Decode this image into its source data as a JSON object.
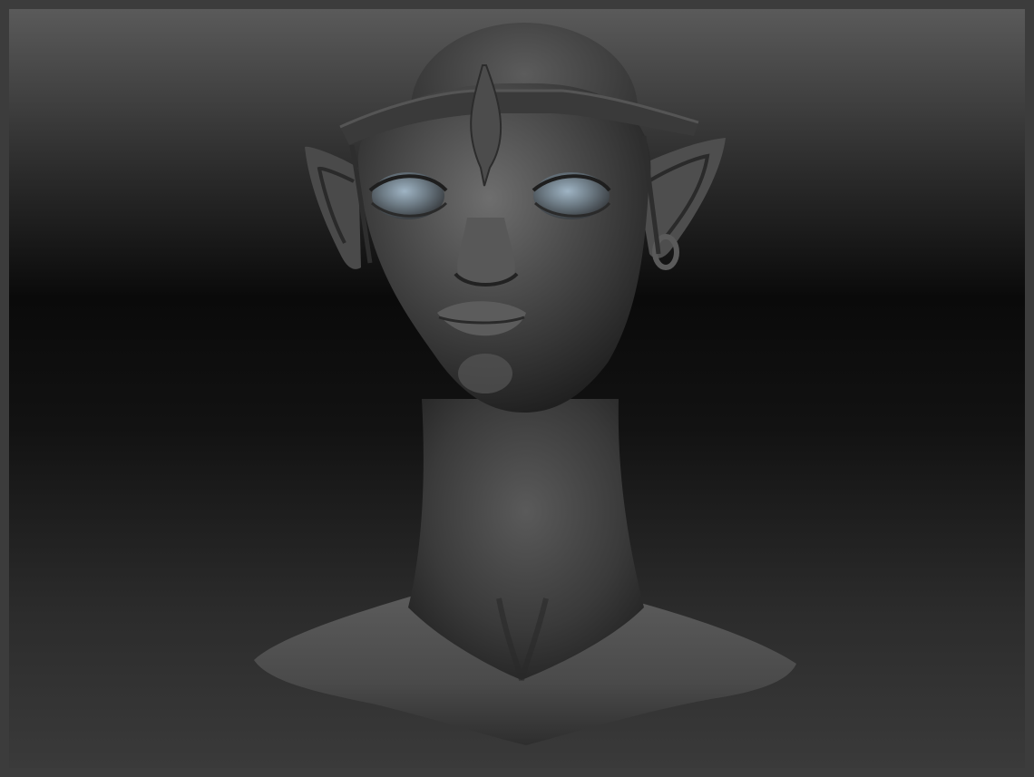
{
  "scene": {
    "subject": "sculpted-bust",
    "colors": {
      "frame": "#3c3c3c",
      "background_top": "#5a5a5a",
      "background_mid": "#0a0a0a",
      "background_bottom": "#3a3a3a",
      "clay_light": "#7a7a7a",
      "clay_mid": "#4a4a4a",
      "clay_dark": "#1e1e1e",
      "eye_tint": "#8fa6b8"
    }
  }
}
